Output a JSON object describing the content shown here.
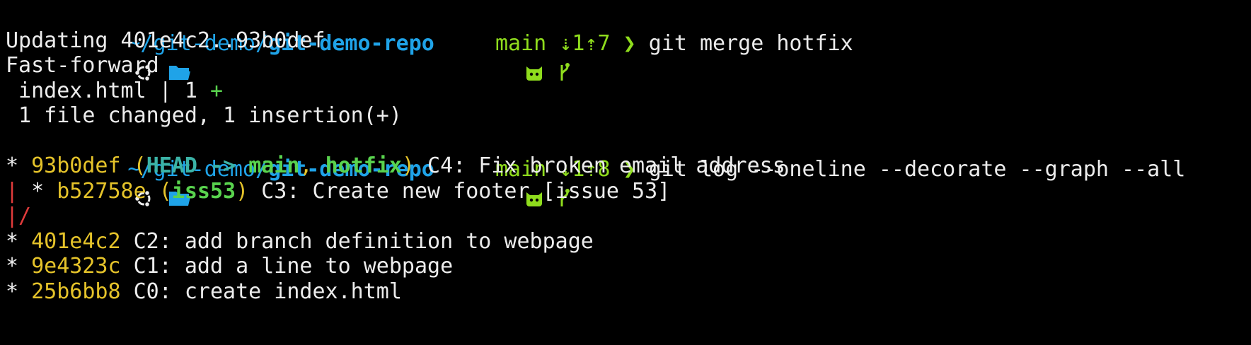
{
  "window": {
    "background": "#000000",
    "foreground": "#ececec"
  },
  "colors": {
    "path": "#1fa3e8",
    "git_info": "#8fdc1d",
    "hash": "#e5c32a",
    "head": "#3bb3a7",
    "branch": "#59d34e",
    "graph_red": "#e03b3b"
  },
  "prompt": {
    "distro_icon": "ubuntu-logo-icon",
    "folder_icon": "folder-icon",
    "github_icon": "github-octocat-icon",
    "branch_icon": "git-branch-icon",
    "path_dir": "~/git-demo/",
    "path_repo": "git-demo-repo",
    "branch": "main",
    "chevron": "❯"
  },
  "prompt1": {
    "status": "⇣1⇡7",
    "command": "git merge hotfix"
  },
  "merge_output": {
    "line1": "Updating 401e4c2..93b0def",
    "line2": "Fast-forward",
    "file_stat_file": " index.html | 1 ",
    "file_stat_plus": "+",
    "summary": " 1 file changed, 1 insertion(+)"
  },
  "prompt2": {
    "status": "⇣1⇡8",
    "command": "git log --oneline --decorate --graph --all"
  },
  "log": {
    "rows": [
      {
        "graph": "* ",
        "hash": "93b0def",
        "paren_open": " (",
        "head": "HEAD -> ",
        "branch1": "main",
        "sep": ", ",
        "branch2": "hotfix",
        "paren_close": ")",
        "message": " C4: Fix broken email address"
      },
      {
        "graph_red": "| ",
        "graph": "* ",
        "hash": "b52758e",
        "paren_open": " (",
        "branch1": "iss53",
        "paren_close": ")",
        "message": " C3: Create new footer [issue 53]"
      },
      {
        "graph_red": "|/"
      },
      {
        "graph": "* ",
        "hash": "401e4c2",
        "message": " C2: add branch definition to webpage"
      },
      {
        "graph": "* ",
        "hash": "9e4323c",
        "message": " C1: add a line to webpage"
      },
      {
        "graph": "* ",
        "hash": "25b6bb8",
        "message": " C0: create index.html"
      }
    ]
  }
}
